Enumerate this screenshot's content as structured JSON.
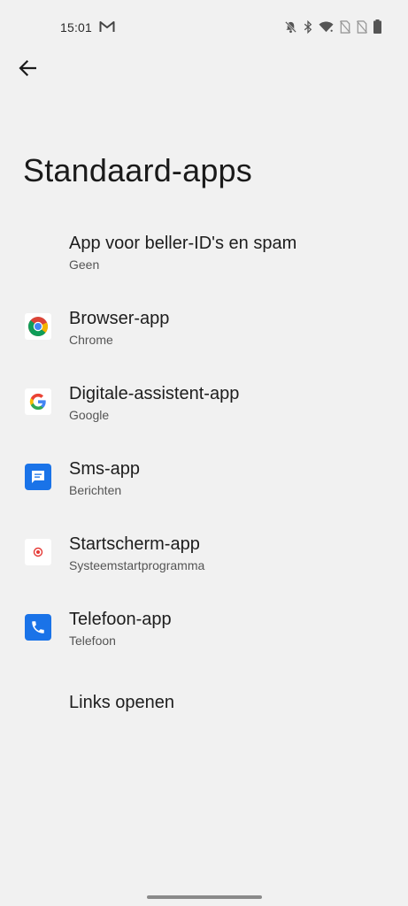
{
  "status_bar": {
    "time": "15:01",
    "notification_icons": [
      "gmail-icon"
    ],
    "system_icons": [
      "notifications-off-icon",
      "bluetooth-icon",
      "wifi-icon",
      "no-sim-icon",
      "no-sim-icon",
      "battery-icon"
    ]
  },
  "header": {
    "back_icon": "arrow-back-icon",
    "title": "Standaard-apps"
  },
  "items": [
    {
      "title": "App voor beller-ID's en spam",
      "subtitle": "Geen",
      "icon": "none"
    },
    {
      "title": "Browser-app",
      "subtitle": "Chrome",
      "icon": "chrome-icon"
    },
    {
      "title": "Digitale-assistent-app",
      "subtitle": "Google",
      "icon": "google-icon"
    },
    {
      "title": "Sms-app",
      "subtitle": "Berichten",
      "icon": "messages-icon"
    },
    {
      "title": "Startscherm-app",
      "subtitle": "Systeemstartprogramma",
      "icon": "launcher-icon"
    },
    {
      "title": "Telefoon-app",
      "subtitle": "Telefoon",
      "icon": "phone-icon"
    },
    {
      "title": "Links openen",
      "subtitle": "",
      "icon": "none"
    }
  ],
  "colors": {
    "background": "#f1f1f1",
    "accent_blue": "#1a73e8"
  }
}
